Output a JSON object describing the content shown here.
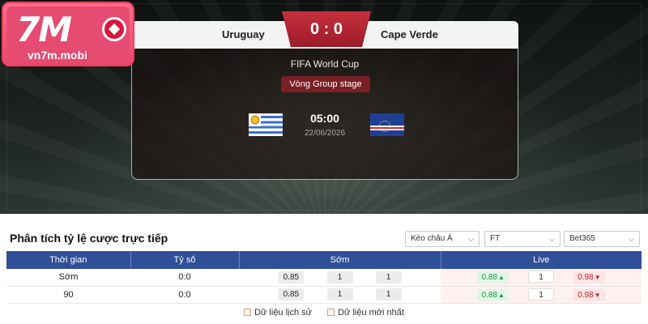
{
  "logo": {
    "mark": "7M",
    "domain": "vn7m.mobi"
  },
  "match": {
    "home_team": "Uruguay",
    "away_team": "Cape Verde",
    "score": "0 : 0",
    "competition": "FIFA World Cup",
    "stage": "Vòng Group stage",
    "kickoff_time": "05:00",
    "kickoff_date": "22/06/2026",
    "home_flag": "uruguay-flag",
    "away_flag": "cape-verde-flag"
  },
  "odds": {
    "title": "Phân tích tỷ lệ cược trực tiếp",
    "filters": {
      "handicap": "Kèo châu Á",
      "period": "FT",
      "bookmaker": "Bet365"
    },
    "headers": {
      "time": "Thời gian",
      "score": "Tỷ số",
      "early": "Sớm",
      "live": "Live"
    },
    "rows": [
      {
        "time": "Sớm",
        "score": "0:0",
        "early": [
          "0.85",
          "1",
          "1"
        ],
        "live": [
          "0.88",
          "1",
          "0.98"
        ]
      },
      {
        "time": "90",
        "score": "0:0",
        "early": [
          "0.85",
          "1",
          "1"
        ],
        "live": [
          "0.88",
          "1",
          "0.98"
        ]
      }
    ],
    "legend": {
      "history": "Dữ liệu lịch sử",
      "latest": "Dữ liệu mới nhất"
    }
  },
  "colors": {
    "accent_red": "#b8232f",
    "header_blue": "#2f4f98",
    "brand_pink": "#e64b72"
  }
}
